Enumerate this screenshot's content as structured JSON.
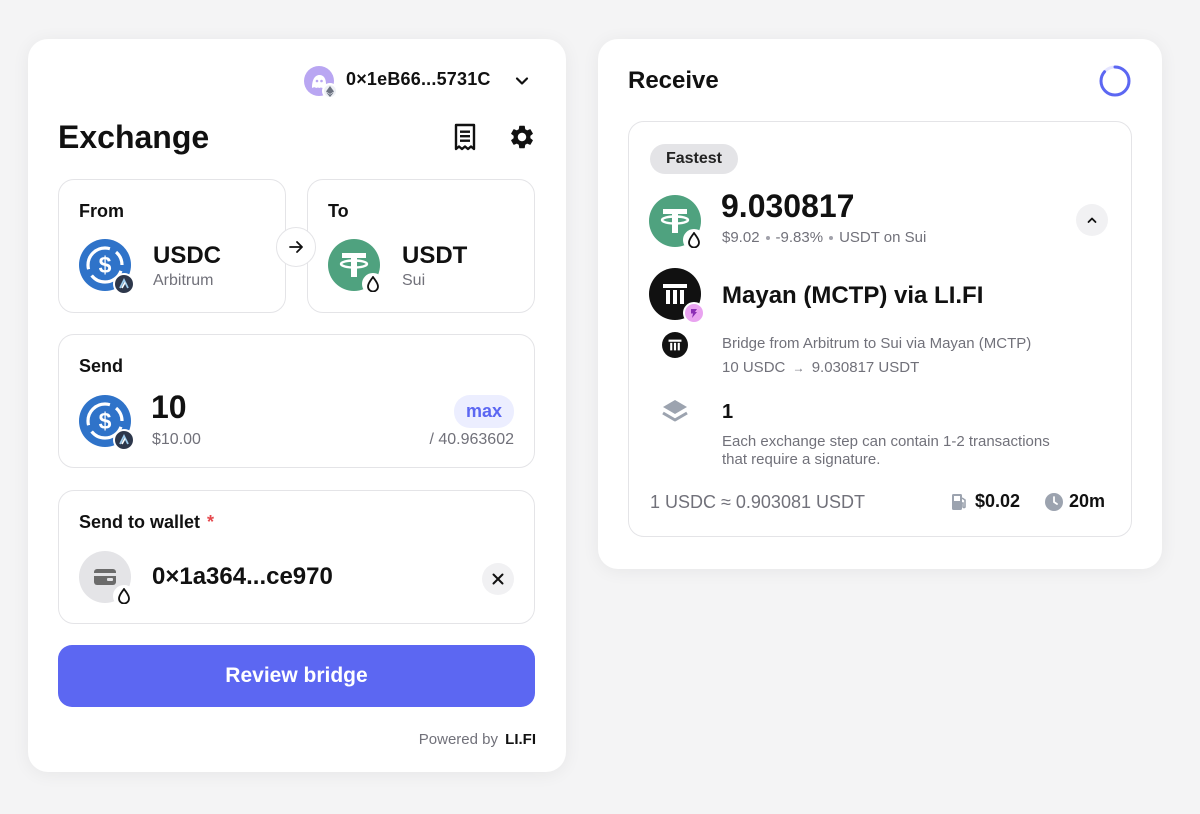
{
  "exchange": {
    "wallet": {
      "address": "0×1eB66...5731C"
    },
    "title": "Exchange",
    "from": {
      "label": "From",
      "token": "USDC",
      "chain": "Arbitrum"
    },
    "to": {
      "label": "To",
      "token": "USDT",
      "chain": "Sui"
    },
    "send": {
      "label": "Send",
      "amount": "10",
      "usd_value": "$10.00",
      "max_label": "max",
      "balance": "/ 40.963602"
    },
    "send_to_wallet": {
      "label": "Send to wallet",
      "required_mark": "*",
      "address": "0×1a364...ce970"
    },
    "review_button": "Review bridge",
    "powered_by": {
      "text": "Powered by",
      "brand": "LI.FI"
    }
  },
  "receive": {
    "title": "Receive",
    "badge": "Fastest",
    "amount": "9.030817",
    "usd_value": "$9.02",
    "price_impact": "-9.83%",
    "token_on_chain": "USDT on Sui",
    "provider": "Mayan (MCTP) via LI.FI",
    "step": {
      "description": "Bridge from Arbitrum to Sui via Mayan (MCTP)",
      "from_amount": "10 USDC",
      "arrow": "→",
      "to_amount": "9.030817 USDT"
    },
    "signatures": {
      "count": "1",
      "line1": "Each exchange step can contain 1-2 transactions",
      "line2": "that require a signature."
    },
    "rate": "1 USDC ≈ 0.903081 USDT",
    "gas_cost": "$0.02",
    "duration": "20m"
  },
  "colors": {
    "accent": "#5c67f2",
    "usdc": "#2f73c9",
    "usdt": "#4fa27f",
    "required": "#e5484d"
  }
}
